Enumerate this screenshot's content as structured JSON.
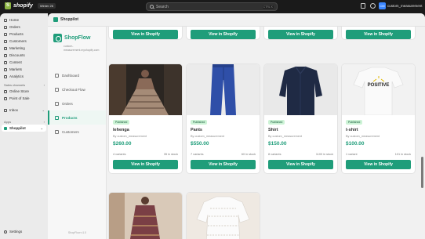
{
  "topbar": {
    "brand": "shopify",
    "store_chip": "Winter 26",
    "search_placeholder": "Search",
    "search_shortcut": "CTRL K",
    "user_initials": "CM",
    "user_name": "custom_measurement"
  },
  "leftnav": {
    "items": [
      {
        "label": "Home",
        "icon": "home-icon"
      },
      {
        "label": "Orders",
        "icon": "orders-icon"
      },
      {
        "label": "Products",
        "icon": "products-icon"
      },
      {
        "label": "Customers",
        "icon": "customers-icon"
      },
      {
        "label": "Marketing",
        "icon": "marketing-icon"
      },
      {
        "label": "Discounts",
        "icon": "discounts-icon"
      },
      {
        "label": "Content",
        "icon": "content-icon"
      },
      {
        "label": "Markets",
        "icon": "markets-icon"
      },
      {
        "label": "Analytics",
        "icon": "analytics-icon"
      }
    ],
    "sales_channels_label": "Sales channels",
    "channels": [
      {
        "label": "Online Store",
        "icon": "online-store-icon"
      },
      {
        "label": "Point of Sale",
        "icon": "pos-icon"
      }
    ],
    "inbox_label": "Inbox",
    "apps_label": "Apps",
    "active_app": "Shoppilot",
    "settings_label": "Settings"
  },
  "app": {
    "header_title": "Shoppilot",
    "logo_name": "ShopFlow",
    "shop_domain": "custom-measurement.myshopify.com",
    "nav": [
      {
        "label": "Dashboard",
        "icon": "dashboard-icon",
        "active": false
      },
      {
        "label": "Checkout Flow",
        "icon": "checkout-flow-icon",
        "active": false
      },
      {
        "label": "Orders",
        "icon": "orders-icon",
        "active": false
      },
      {
        "label": "Products",
        "icon": "products-icon",
        "active": true
      },
      {
        "label": "Customers",
        "icon": "customers-icon",
        "active": false
      }
    ],
    "version": "ShopFlow v1.0"
  },
  "view_button_label": "View in Shopify",
  "products": [
    {
      "title": "lehenga",
      "status": "Published",
      "by": "By custom_measurement",
      "price": "$260.00",
      "variants": "4 variants",
      "stock": "35 in stock",
      "image": "lehenga-photo"
    },
    {
      "title": "Pants",
      "status": "Published",
      "by": "By custom_measurement",
      "price": "$550.00",
      "variants": "7 variants",
      "stock": "60 in stock",
      "image": "blue-pants-photo"
    },
    {
      "title": "Shirt",
      "status": "Published",
      "by": "By custom_measurement",
      "price": "$150.00",
      "variants": "8 variants",
      "stock": "1100 in stock",
      "image": "navy-shirt-photo"
    },
    {
      "title": "t-shirt",
      "status": "Published",
      "by": "By custom_measurement",
      "price": "$100.00",
      "variants": "1 variant",
      "stock": "101 in stock",
      "image": "positive-tshirt-photo"
    }
  ],
  "tshirt_print": "POSITIVE",
  "colors": {
    "accent": "#1f9d7a",
    "badge_bg": "#cdf3d6",
    "badge_text": "#0c5132"
  }
}
